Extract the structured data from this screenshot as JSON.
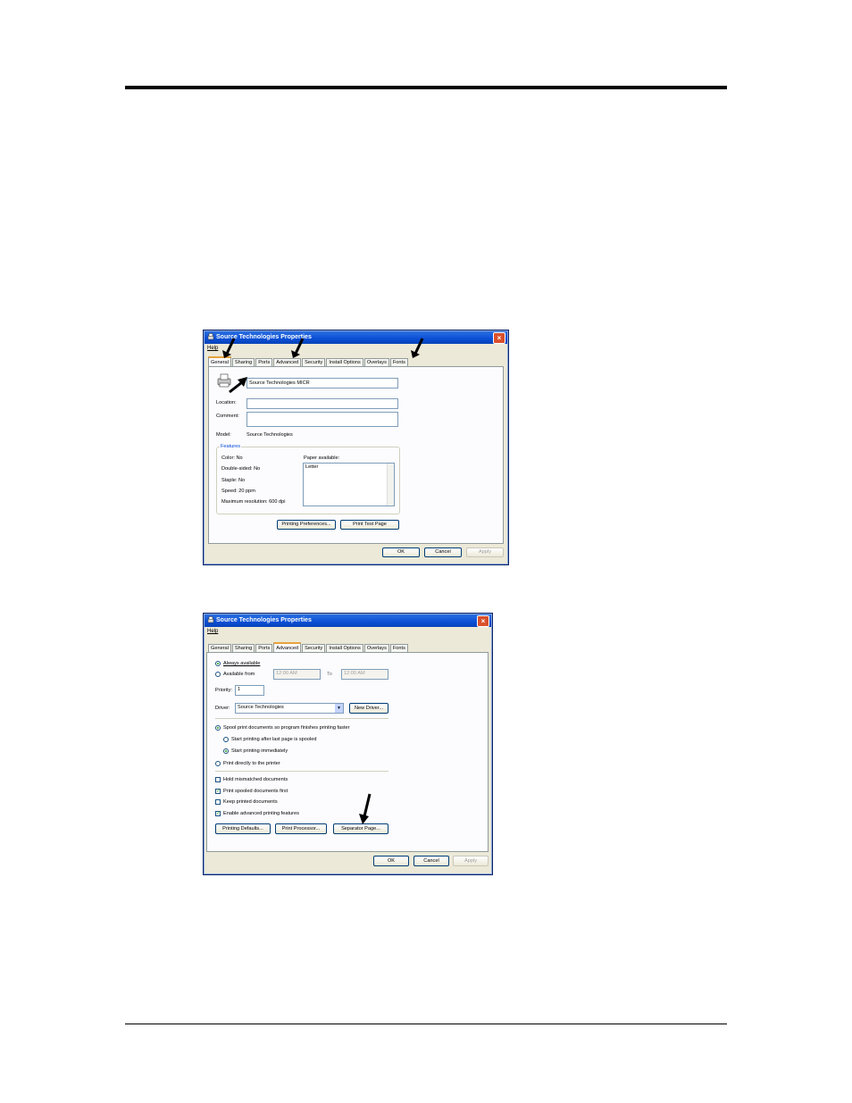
{
  "dialog1": {
    "title": "Source Technologies Properties",
    "menu_help": "Help",
    "tabs": [
      "General",
      "Sharing",
      "Ports",
      "Advanced",
      "Security",
      "Install Options",
      "Overlays",
      "Fonts"
    ],
    "active_tab": "General",
    "printer_name": "Source Technologies MICR",
    "location_label": "Location:",
    "location_value": "",
    "comment_label": "Comment:",
    "comment_value": "",
    "model_label": "Model:",
    "model_value": "Source Technologies",
    "features": {
      "title": "Features",
      "color": "Color: No",
      "double_sided": "Double-sided: No",
      "staple": "Staple: No",
      "speed": "Speed: 20 ppm",
      "max_resolution": "Maximum resolution: 600 dpi",
      "paper_label": "Paper available:",
      "paper_items": [
        "Letter"
      ]
    },
    "btn_printing_prefs": "Printing Preferences...",
    "btn_print_test": "Print Test Page",
    "btn_ok": "OK",
    "btn_cancel": "Cancel",
    "btn_apply": "Apply"
  },
  "dialog2": {
    "title": "Source Technologies Properties",
    "menu_help": "Help",
    "tabs": [
      "General",
      "Sharing",
      "Ports",
      "Advanced",
      "Security",
      "Install Options",
      "Overlays",
      "Fonts"
    ],
    "active_tab": "Advanced",
    "always_available": "Always available",
    "available_from": "Available from",
    "time_from": "12:00 AM",
    "to_label": "To",
    "time_to": "12:00 AM",
    "priority_label": "Priority:",
    "priority_value": "1",
    "driver_label": "Driver:",
    "driver_value": "Source Technologies",
    "btn_new_driver": "New Driver...",
    "spool_option": "Spool print documents so program finishes printing faster",
    "start_after_last": "Start printing after last page is spooled",
    "start_immediately": "Start printing immediately",
    "print_directly": "Print directly to the printer",
    "hold_mismatched": "Hold mismatched documents",
    "print_spooled_first": "Print spooled documents first",
    "keep_printed": "Keep printed documents",
    "enable_advanced": "Enable advanced printing features",
    "checks": {
      "hold": false,
      "spooled_first": true,
      "keep": false,
      "advanced": true
    },
    "btn_printing_defaults": "Printing Defaults...",
    "btn_print_processor": "Print Processor...",
    "btn_separator_page": "Separator Page...",
    "btn_ok": "OK",
    "btn_cancel": "Cancel",
    "btn_apply": "Apply"
  },
  "colors": {
    "titlebar": "#0a4fd6",
    "dialog_bg": "#ece9d8",
    "active_tab_accent": "#e8a33c"
  }
}
